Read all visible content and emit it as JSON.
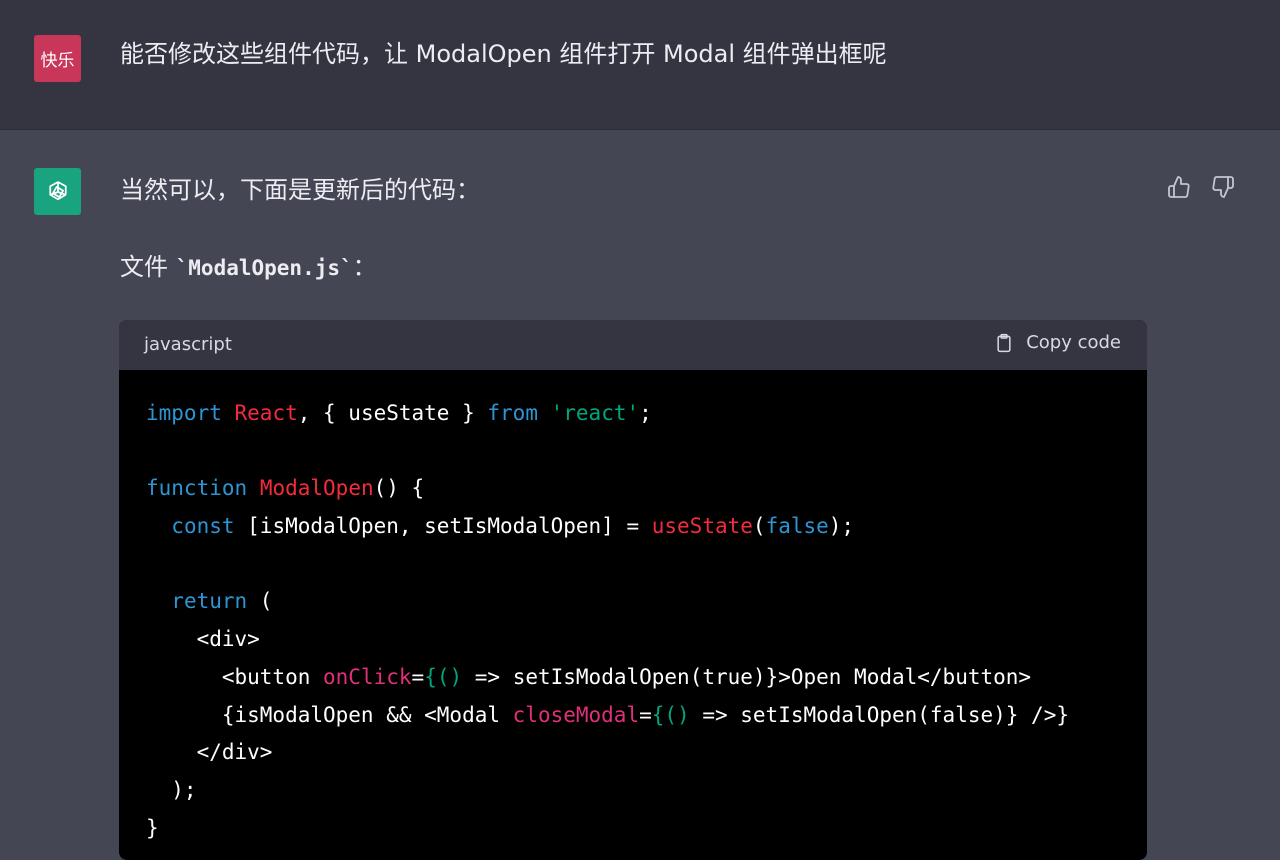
{
  "user_message": {
    "avatar_label": "快乐",
    "text": "能否修改这些组件代码，让 ModalOpen 组件打开 Modal 组件弹出框呢"
  },
  "assistant_message": {
    "avatar_icon": "openai-logo-icon",
    "intro": "当然可以，下面是更新后的代码：",
    "file_prefix": "文件 ",
    "file_name": "`ModalOpen.js`",
    "file_suffix": "：",
    "feedback": {
      "thumbs_up_icon": "thumbs-up-icon",
      "thumbs_down_icon": "thumbs-down-icon"
    }
  },
  "code_block": {
    "language": "javascript",
    "copy_label": "Copy code",
    "copy_icon": "clipboard-icon",
    "colors": {
      "keyword": "#2e95d3",
      "class_name": "#f22c3d",
      "string": "#00a67d",
      "attribute": "#df3079",
      "text": "#ffffff"
    },
    "lines": [
      [
        [
          "kw",
          "import"
        ],
        [
          "plain",
          " "
        ],
        [
          "cls",
          "React"
        ],
        [
          "plain",
          ", { useState } "
        ],
        [
          "kw",
          "from"
        ],
        [
          "plain",
          " "
        ],
        [
          "str",
          "'react'"
        ],
        [
          "plain",
          ";"
        ]
      ],
      [],
      [
        [
          "kw",
          "function"
        ],
        [
          "plain",
          " "
        ],
        [
          "cls",
          "ModalOpen"
        ],
        [
          "plain",
          "() {"
        ]
      ],
      [
        [
          "plain",
          "  "
        ],
        [
          "kw",
          "const"
        ],
        [
          "plain",
          " [isModalOpen, setIsModalOpen] = "
        ],
        [
          "cls",
          "useState"
        ],
        [
          "plain",
          "("
        ],
        [
          "kw",
          "false"
        ],
        [
          "plain",
          ");"
        ]
      ],
      [],
      [
        [
          "plain",
          "  "
        ],
        [
          "kw",
          "return"
        ],
        [
          "plain",
          " ("
        ]
      ],
      [
        [
          "plain",
          "    <div>"
        ]
      ],
      [
        [
          "plain",
          "      <button "
        ],
        [
          "attr",
          "onClick"
        ],
        [
          "plain",
          "="
        ],
        [
          "brace",
          "{()"
        ],
        [
          "plain",
          " => setIsModalOpen(true)}>Open Modal</button>"
        ]
      ],
      [
        [
          "plain",
          "      {isModalOpen && <Modal "
        ],
        [
          "attr",
          "closeModal"
        ],
        [
          "plain",
          "="
        ],
        [
          "brace",
          "{()"
        ],
        [
          "plain",
          " => setIsModalOpen(false)} />}"
        ]
      ],
      [
        [
          "plain",
          "    </div>"
        ]
      ],
      [
        [
          "plain",
          "  );"
        ]
      ],
      [
        [
          "plain",
          "}"
        ]
      ]
    ]
  }
}
